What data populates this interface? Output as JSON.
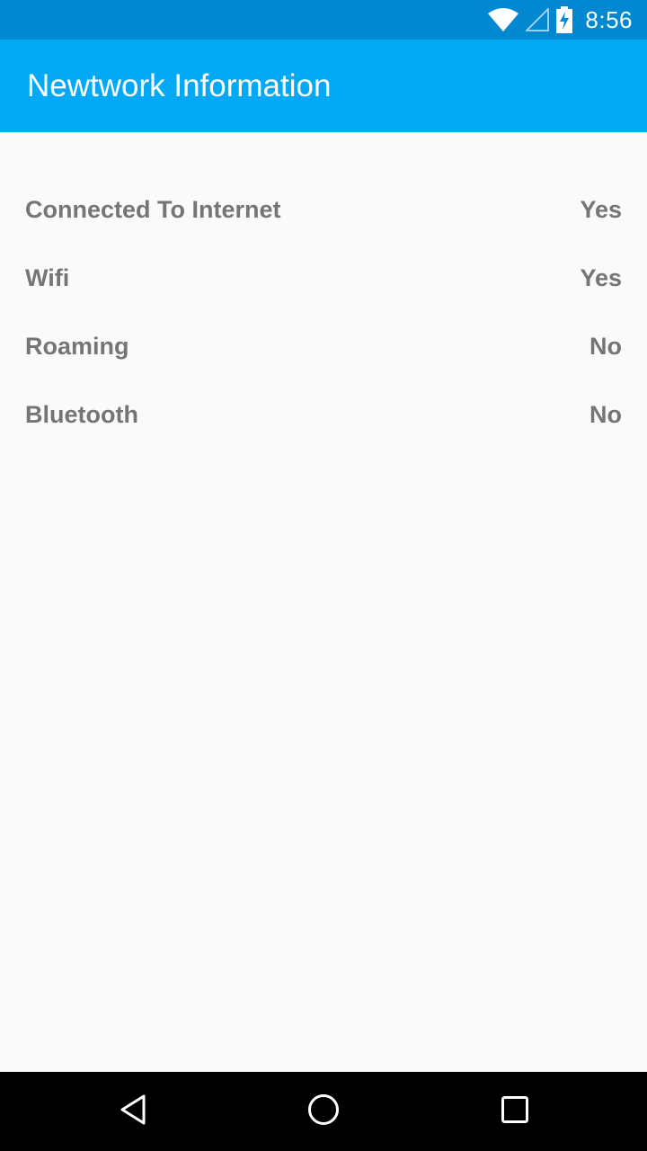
{
  "status_bar": {
    "time": "8:56",
    "icons": [
      "wifi-icon",
      "cell-signal-icon",
      "battery-charging-icon"
    ]
  },
  "app_bar": {
    "title": "Newtwork Information"
  },
  "info": {
    "rows": [
      {
        "label": "Connected To Internet",
        "value": "Yes"
      },
      {
        "label": "Wifi",
        "value": "Yes"
      },
      {
        "label": "Roaming",
        "value": "No"
      },
      {
        "label": "Bluetooth",
        "value": "No"
      }
    ]
  },
  "nav_bar": {
    "buttons": [
      "back-icon",
      "home-icon",
      "recents-icon"
    ]
  },
  "colors": {
    "status_bar": "#0288d1",
    "app_bar": "#03a9f4",
    "background": "#fafafa",
    "row_text": "#757575",
    "nav_bar": "#000000"
  }
}
